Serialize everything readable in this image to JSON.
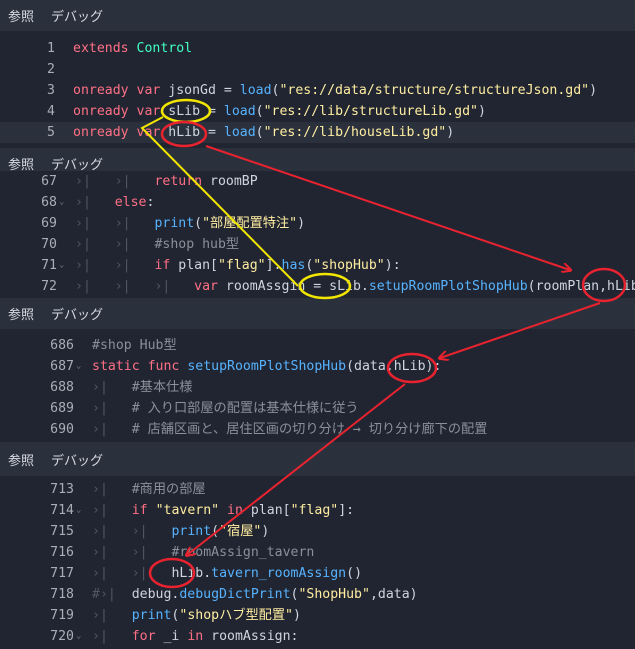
{
  "toolbar": {
    "reference": "参照",
    "debug": "デバッグ"
  },
  "panel1": {
    "lines": [
      {
        "n": "1",
        "parts": [
          [
            "kw",
            "extends"
          ],
          [
            "p",
            " "
          ],
          [
            "ty",
            "Control"
          ]
        ]
      },
      {
        "n": "2",
        "parts": []
      },
      {
        "n": "3",
        "parts": [
          [
            "kw",
            "onready"
          ],
          [
            "p",
            " "
          ],
          [
            "kw",
            "var"
          ],
          [
            "p",
            " jsonGd = "
          ],
          [
            "fn",
            "load"
          ],
          [
            "p",
            "("
          ],
          [
            "str",
            "\"res://data/structure/structureJson.gd\""
          ],
          [
            "p",
            ")"
          ]
        ]
      },
      {
        "n": "4",
        "parts": [
          [
            "kw",
            "onready"
          ],
          [
            "p",
            " "
          ],
          [
            "kw",
            "var"
          ],
          [
            "p",
            " sLib = "
          ],
          [
            "fn",
            "load"
          ],
          [
            "p",
            "("
          ],
          [
            "str",
            "\"res://lib/structureLib.gd\""
          ],
          [
            "p",
            ")"
          ]
        ]
      },
      {
        "n": "5",
        "parts": [
          [
            "kw",
            "onready"
          ],
          [
            "p",
            " "
          ],
          [
            "kw",
            "var"
          ],
          [
            "p",
            " hLib = "
          ],
          [
            "fn",
            "load"
          ],
          [
            "p",
            "("
          ],
          [
            "str",
            "\"res://lib/houseLib.gd\""
          ],
          [
            "p",
            ")"
          ]
        ]
      }
    ]
  },
  "panel2": {
    "lines": [
      {
        "n": "67",
        "fold": "",
        "parts": [
          [
            "t",
            "›|"
          ],
          [
            "p",
            "   "
          ],
          [
            "t",
            "›|"
          ],
          [
            "p",
            "   "
          ],
          [
            "kw",
            "return"
          ],
          [
            "p",
            " roomBP"
          ]
        ]
      },
      {
        "n": "68",
        "fold": "⌄",
        "parts": [
          [
            "t",
            "›|"
          ],
          [
            "p",
            "   "
          ],
          [
            "kw",
            "else"
          ],
          [
            "p",
            ":"
          ]
        ]
      },
      {
        "n": "69",
        "fold": "",
        "parts": [
          [
            "t",
            "›|"
          ],
          [
            "p",
            "   "
          ],
          [
            "t",
            "›|"
          ],
          [
            "p",
            "   "
          ],
          [
            "fn",
            "print"
          ],
          [
            "p",
            "("
          ],
          [
            "str",
            "\"部屋配置特注\""
          ],
          [
            "p",
            ")"
          ]
        ]
      },
      {
        "n": "70",
        "fold": "",
        "parts": [
          [
            "t",
            "›|"
          ],
          [
            "p",
            "   "
          ],
          [
            "t",
            "›|"
          ],
          [
            "p",
            "   "
          ],
          [
            "cm",
            "#shop hub型"
          ]
        ]
      },
      {
        "n": "71",
        "fold": "⌄",
        "parts": [
          [
            "t",
            "›|"
          ],
          [
            "p",
            "   "
          ],
          [
            "t",
            "›|"
          ],
          [
            "p",
            "   "
          ],
          [
            "kw",
            "if"
          ],
          [
            "p",
            " plan["
          ],
          [
            "str",
            "\"flag\""
          ],
          [
            "p",
            "]."
          ],
          [
            "fn",
            "has"
          ],
          [
            "p",
            "("
          ],
          [
            "str",
            "\"shopHub\""
          ],
          [
            "p",
            "):"
          ]
        ]
      },
      {
        "n": "72",
        "fold": "",
        "parts": [
          [
            "t",
            "›|"
          ],
          [
            "p",
            "   "
          ],
          [
            "t",
            "›|"
          ],
          [
            "p",
            "   "
          ],
          [
            "t",
            "›|"
          ],
          [
            "p",
            "   "
          ],
          [
            "kw",
            "var"
          ],
          [
            "p",
            " roomAssgin = sLib."
          ],
          [
            "fn",
            "setupRoomPlotShopHub"
          ],
          [
            "p",
            "(roomPlan,hLib)"
          ]
        ]
      }
    ]
  },
  "panel3": {
    "lines": [
      {
        "n": "686",
        "fold": "",
        "parts": [
          [
            "cm",
            "#shop Hub型"
          ]
        ]
      },
      {
        "n": "687",
        "fold": "⌄",
        "parts": [
          [
            "kw",
            "static"
          ],
          [
            "p",
            " "
          ],
          [
            "kw",
            "func"
          ],
          [
            "p",
            " "
          ],
          [
            "fn",
            "setupRoomPlotShopHub"
          ],
          [
            "p",
            "(data,hLib):"
          ]
        ]
      },
      {
        "n": "688",
        "fold": "",
        "parts": [
          [
            "t",
            "›|"
          ],
          [
            "p",
            "   "
          ],
          [
            "cm",
            "#基本仕様"
          ]
        ]
      },
      {
        "n": "689",
        "fold": "",
        "parts": [
          [
            "t",
            "›|"
          ],
          [
            "p",
            "   "
          ],
          [
            "cm",
            "# 入り口部屋の配置は基本仕様に従う"
          ]
        ]
      },
      {
        "n": "690",
        "fold": "",
        "parts": [
          [
            "t",
            "›|"
          ],
          [
            "p",
            "   "
          ],
          [
            "cm",
            "# 店舗区画と、居住区画の切り分け → 切り分け廊下の配置"
          ]
        ]
      }
    ]
  },
  "panel4": {
    "lines": [
      {
        "n": "713",
        "fold": "",
        "parts": [
          [
            "t",
            "›|"
          ],
          [
            "p",
            "   "
          ],
          [
            "cm",
            "#商用の部屋"
          ]
        ]
      },
      {
        "n": "714",
        "fold": "⌄",
        "parts": [
          [
            "t",
            "›|"
          ],
          [
            "p",
            "   "
          ],
          [
            "kw",
            "if"
          ],
          [
            "p",
            " "
          ],
          [
            "str",
            "\"tavern\""
          ],
          [
            "p",
            " "
          ],
          [
            "kw",
            "in"
          ],
          [
            "p",
            " plan["
          ],
          [
            "str",
            "\"flag\""
          ],
          [
            "p",
            "]:"
          ]
        ]
      },
      {
        "n": "715",
        "fold": "",
        "parts": [
          [
            "t",
            "›|"
          ],
          [
            "p",
            "   "
          ],
          [
            "t",
            "›|"
          ],
          [
            "p",
            "   "
          ],
          [
            "fn",
            "print"
          ],
          [
            "p",
            "("
          ],
          [
            "str",
            "\"宿屋\""
          ],
          [
            "p",
            ")"
          ]
        ]
      },
      {
        "n": "716",
        "fold": "",
        "parts": [
          [
            "t",
            "›|"
          ],
          [
            "p",
            "   "
          ],
          [
            "t",
            "›|"
          ],
          [
            "p",
            "   "
          ],
          [
            "cm",
            "#roomAssign_tavern"
          ]
        ]
      },
      {
        "n": "717",
        "fold": "",
        "parts": [
          [
            "t",
            "›|"
          ],
          [
            "p",
            "   "
          ],
          [
            "t",
            "›|"
          ],
          [
            "p",
            "   "
          ],
          [
            "p",
            "hLib."
          ],
          [
            "fn",
            "tavern_roomAssign"
          ],
          [
            "p",
            "()"
          ]
        ]
      },
      {
        "n": "718",
        "fold": "",
        "parts": [
          [
            "t",
            "#›|"
          ],
          [
            "p",
            "  "
          ],
          [
            "p",
            "debug."
          ],
          [
            "fn",
            "debugDictPrint"
          ],
          [
            "p",
            "("
          ],
          [
            "str",
            "\"ShopHub\""
          ],
          [
            "p",
            ",data)"
          ]
        ]
      },
      {
        "n": "719",
        "fold": "",
        "parts": [
          [
            "t",
            "›|"
          ],
          [
            "p",
            "   "
          ],
          [
            "fn",
            "print"
          ],
          [
            "p",
            "("
          ],
          [
            "str",
            "\"shopハブ型配置\""
          ],
          [
            "p",
            ")"
          ]
        ]
      },
      {
        "n": "720",
        "fold": "⌄",
        "parts": [
          [
            "t",
            "›|"
          ],
          [
            "p",
            "   "
          ],
          [
            "kw",
            "for"
          ],
          [
            "p",
            " _i "
          ],
          [
            "kw",
            "in"
          ],
          [
            "p",
            " roomAssign:"
          ]
        ]
      }
    ]
  }
}
